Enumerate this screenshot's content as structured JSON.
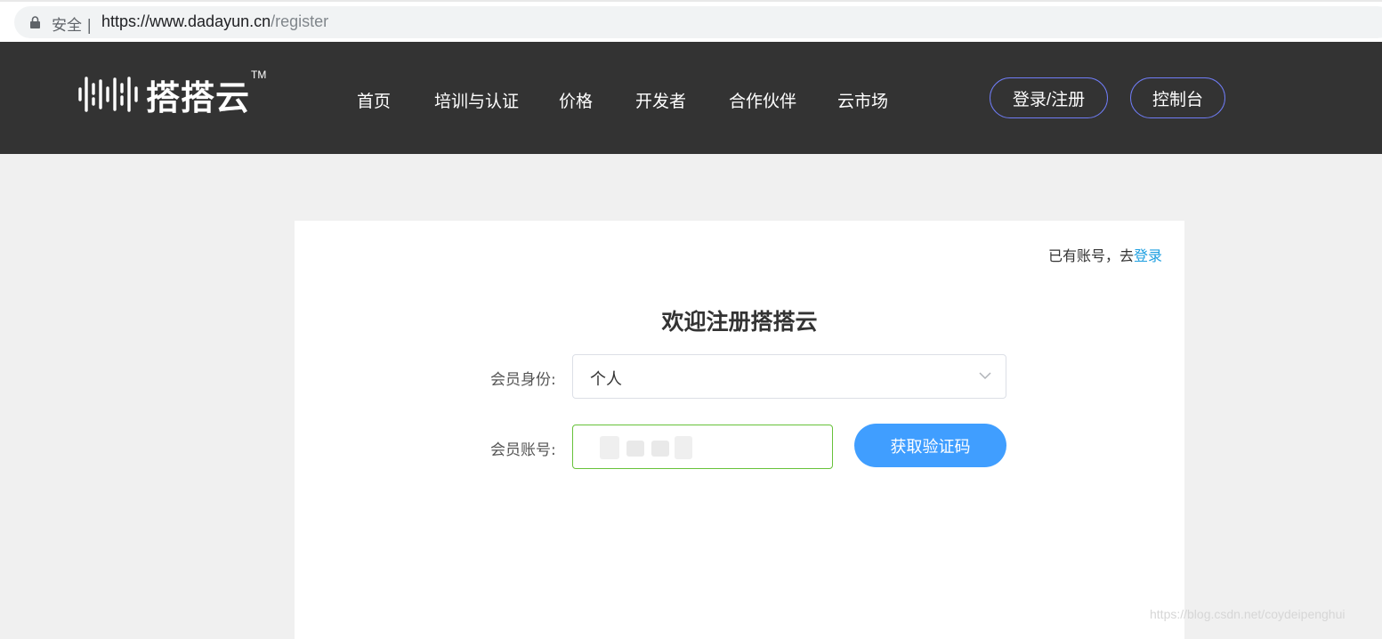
{
  "browser": {
    "secure_label": "安全 |",
    "url_host": "https://www.dadayun.cn",
    "url_path": "/register",
    "icons": {
      "lock": "lock-icon"
    }
  },
  "header": {
    "logo_text": "搭搭云",
    "logo_tm": "TM",
    "nav": [
      "首页",
      "培训与认证",
      "价格",
      "开发者",
      "合作伙伴",
      "云市场"
    ],
    "login_button": "登录/注册",
    "console_button": "控制台",
    "colors": {
      "background": "#333333",
      "button_border": "#6f7cf5"
    }
  },
  "register": {
    "has_account_prefix": "已有账号，去",
    "login_link": "登录",
    "title": "欢迎注册搭搭云",
    "member_type_label": "会员身份:",
    "member_type_value": "个人",
    "account_label": "会员账号:",
    "account_value": "",
    "get_code_button": "获取验证码",
    "colors": {
      "link": "#1e9fe0",
      "primary": "#409eff",
      "input_valid": "#67c23a"
    }
  },
  "watermark": "https://blog.csdn.net/coydeipenghui"
}
